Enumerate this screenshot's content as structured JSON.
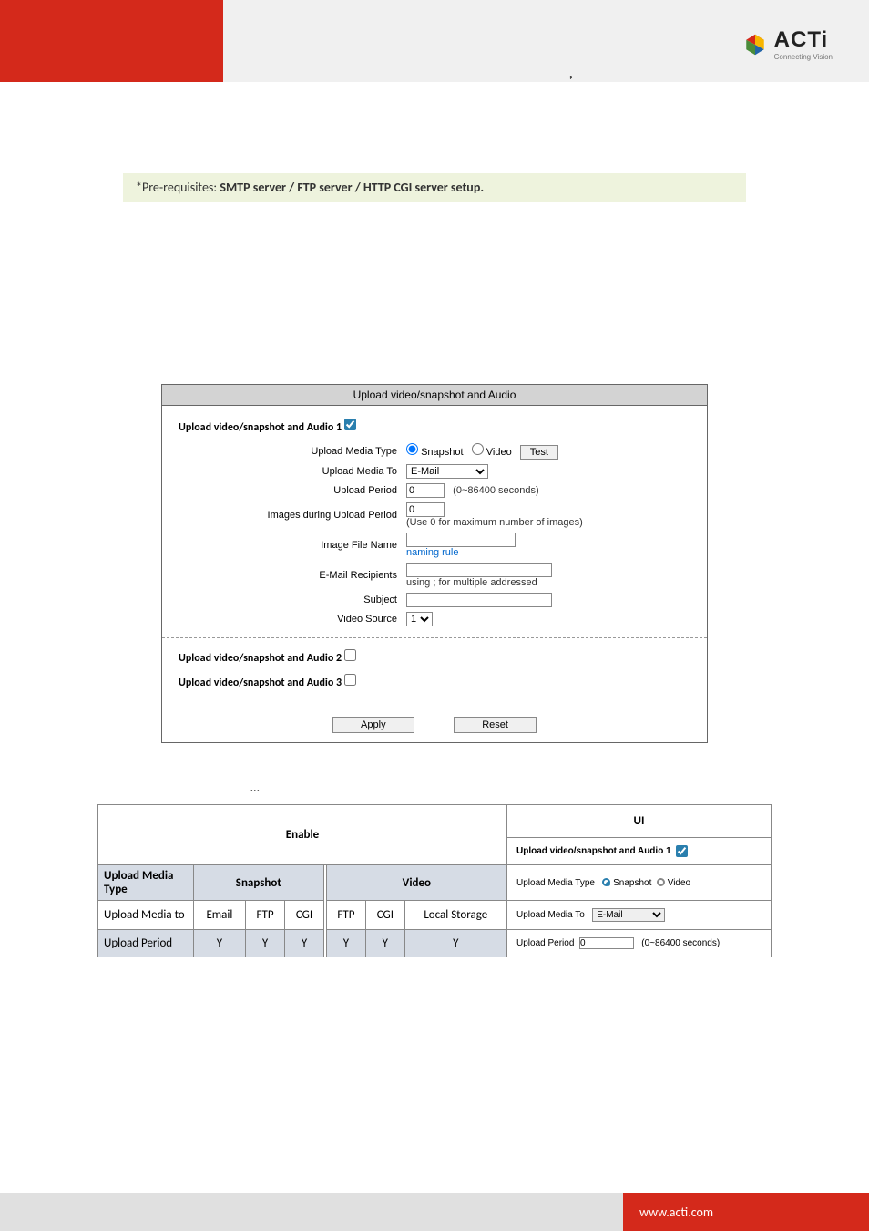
{
  "header": {
    "comma": ",",
    "logo_name": "ACTi",
    "logo_tag": "Connecting Vision"
  },
  "prereq": {
    "prefix": "*Pre-requisites: ",
    "bold": "SMTP server / FTP server / HTTP CGI server setup."
  },
  "screenshot": {
    "title": "Upload video/snapshot and Audio",
    "row1_label": "Upload video/snapshot and Audio  1",
    "upload_media_type_label": "Upload Media Type",
    "opt_snapshot": "Snapshot",
    "opt_video": "Video",
    "test_btn": "Test",
    "upload_media_to_label": "Upload Media To",
    "upload_media_to_value": "E-Mail",
    "upload_period_label": "Upload Period",
    "upload_period_value": "0",
    "upload_period_hint": "(0~86400 seconds)",
    "images_during_label": "Images during Upload Period",
    "images_during_value": "0",
    "images_during_hint": "(Use 0 for maximum number of images)",
    "image_file_name_label": "Image File Name",
    "naming_rule": "naming rule",
    "email_recipients_label": "E-Mail Recipients",
    "email_recipients_hint": "using ; for multiple addressed",
    "subject_label": "Subject",
    "video_source_label": "Video Source",
    "video_source_value": "1",
    "row2_label": "Upload video/snapshot and Audio  2",
    "row3_label": "Upload video/snapshot and Audio  3",
    "apply_btn": "Apply",
    "reset_btn": "Reset"
  },
  "ellipsis": "…",
  "table": {
    "enable_header": "Enable",
    "ui_header": "UI",
    "ui_enable_text": "Upload video/snapshot and Audio  1",
    "upload_media_type": "Upload Media Type",
    "snapshot": "Snapshot",
    "video": "Video",
    "ui_media_type_label": "Upload Media Type",
    "ui_snapshot": "Snapshot",
    "ui_video": "Video",
    "upload_media_to": "Upload Media to",
    "email": "Email",
    "ftp": "FTP",
    "cgi": "CGI",
    "local_storage": "Local Storage",
    "ui_media_to_label": "Upload Media To",
    "ui_media_to_value": "E-Mail",
    "upload_period": "Upload Period",
    "Y": "Y",
    "ui_period_label": "Upload Period",
    "ui_period_value": "0",
    "ui_period_hint": "(0~86400 seconds)"
  },
  "footer": {
    "url": "www.acti.com"
  }
}
